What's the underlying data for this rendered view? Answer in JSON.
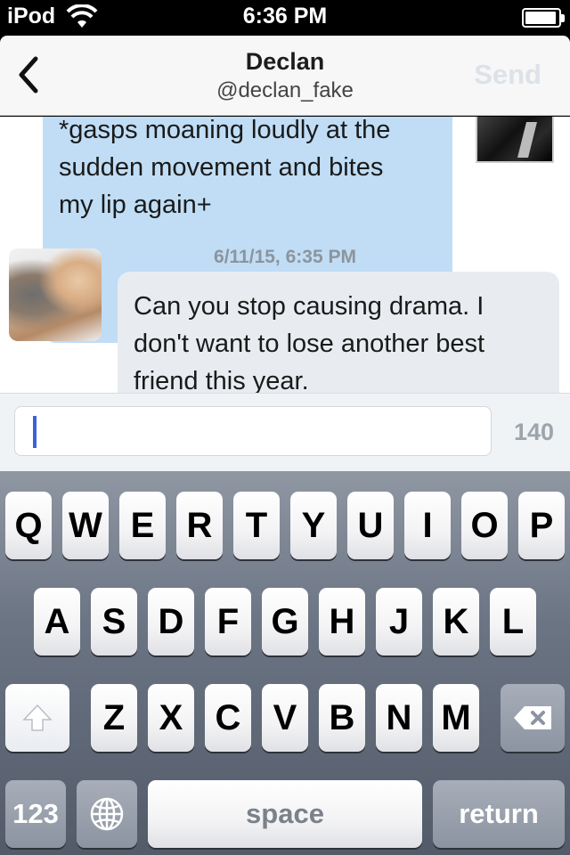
{
  "status_bar": {
    "carrier": "iPod",
    "time": "6:36 PM"
  },
  "nav": {
    "title": "Declan",
    "subtitle": "@declan_fake",
    "send_label": "Send"
  },
  "messages": {
    "outgoing": {
      "lines": [
        "*gasps moaning loudly at the",
        "sudden movement and bites",
        "my lip again+"
      ]
    },
    "timestamp": "6/11/15, 6:35 PM",
    "incoming": {
      "lines": [
        "Can you stop causing drama. I",
        "don't want to lose another best",
        "friend this year."
      ]
    }
  },
  "compose": {
    "value": "",
    "char_count": "140"
  },
  "keyboard": {
    "row1": [
      "Q",
      "W",
      "E",
      "R",
      "T",
      "Y",
      "U",
      "I",
      "O",
      "P"
    ],
    "row2": [
      "A",
      "S",
      "D",
      "F",
      "G",
      "H",
      "J",
      "K",
      "L"
    ],
    "row3": [
      "Z",
      "X",
      "C",
      "V",
      "B",
      "N",
      "M"
    ],
    "numbers_label": "123",
    "space_label": "space",
    "return_label": "return"
  },
  "colors": {
    "outgoing_bubble": "#c0ddf5",
    "incoming_bubble": "#e8ecf0",
    "caret": "#3a62d8"
  }
}
